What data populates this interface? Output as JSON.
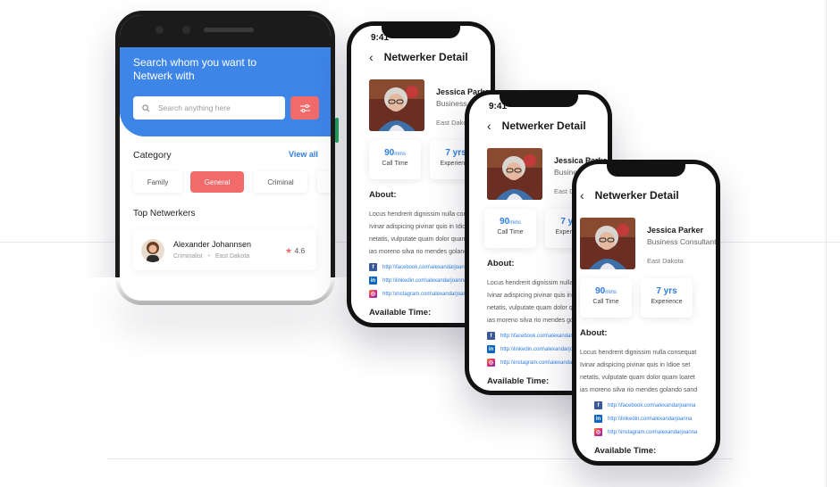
{
  "search_screen": {
    "hero_title_line1": "Search whom you want to",
    "hero_title_line2": "Netwerk with",
    "search_placeholder": "Search anything here",
    "category_title": "Category",
    "view_all": "View all",
    "chips": [
      "Family",
      "General",
      "Criminal"
    ],
    "active_chip": "General",
    "top_netwerkers_title": "Top Netwerkers",
    "netwerker": {
      "name": "Alexander Johannsen",
      "category": "Criminalist",
      "location": "East Dakota",
      "rating": "4.6"
    }
  },
  "detail_screen": {
    "time": "9:41",
    "title": "Netwerker Detail",
    "name": "Jessica Parker",
    "role": "Business Consultant",
    "location": "East Dakota",
    "call_time_value": "90",
    "call_time_unit": "mins",
    "call_time_label": "Call Time",
    "experience_value": "7 yrs",
    "experience_label": "Experience",
    "about_title": "About:",
    "about_lines": [
      "Locus hendrerit dignissim nulla consequat",
      "Ivinar adispicing pivinar quis in Idioe set",
      "netatis, vulputate quam dolor quam loaret",
      "ias moreno silva rio mendes golando sand"
    ],
    "facebook_url": "http:\\\\facebook.com\\alexandarjoanna",
    "linkedin_url": "http:\\\\linkedin.com\\alexandarjoanna",
    "instagram_url": "http:\\\\instagram.com\\alexandarjoanna",
    "available_time_title": "Available Time:"
  },
  "colors": {
    "primary_blue": "#3e85e8",
    "accent_coral": "#f26b6b",
    "link_blue": "#2f7de1"
  },
  "icons": [
    "back-arrow-icon",
    "search-icon",
    "filter-icon",
    "star-icon",
    "facebook-icon",
    "linkedin-icon",
    "instagram-icon"
  ]
}
